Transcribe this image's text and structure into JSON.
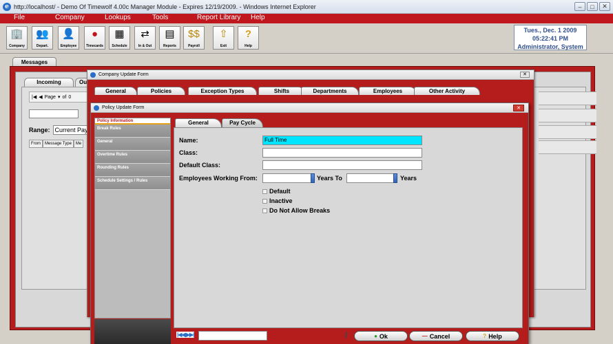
{
  "window": {
    "title": "http://localhost/ - Demo Of Timewolf 4.00c Manager Module - Expires 12/19/2009. - Windows Internet Explorer"
  },
  "menu": [
    "File",
    "Company",
    "Lookups",
    "Tools",
    "Report Library",
    "Help"
  ],
  "toolbar": [
    {
      "label": "Company",
      "icon": "company-icon"
    },
    {
      "label": "Depart.",
      "icon": "department-icon"
    },
    {
      "label": "Employee",
      "icon": "employee-icon"
    },
    {
      "label": "Timecards",
      "icon": "timecards-icon"
    },
    {
      "label": "Schedule",
      "icon": "schedule-icon"
    },
    {
      "label": "In & Out",
      "icon": "in-out-icon"
    },
    {
      "label": "Reports",
      "icon": "reports-icon"
    },
    {
      "label": "Payroll",
      "icon": "payroll-icon"
    },
    {
      "label": "Exit",
      "icon": "exit-icon"
    },
    {
      "label": "Help",
      "icon": "help-icon"
    }
  ],
  "status": {
    "date": "Tues., Dec. 1 2009",
    "time": "05:22:41 PM",
    "user": "Administrator, System"
  },
  "messages": {
    "tab": "Messages",
    "incoming_tab": "Incoming",
    "outgoing_tab": "Ou",
    "pager_label": "Page",
    "pager_of": "of",
    "pager_value": "0",
    "range_label": "Range:",
    "range_value": "Current Pay",
    "columns": [
      "From",
      "Message Type",
      "Me"
    ]
  },
  "company_form": {
    "title": "Company Update Form",
    "close": "✕",
    "tabs": [
      "General",
      "Policies",
      "Exception Types",
      "Shifts",
      "Departments",
      "Employees",
      "Other Activity"
    ],
    "active_tab": "Policies"
  },
  "policy_form": {
    "title": "Policy Update Form",
    "close": "✕",
    "sidebar": [
      "Policy Information",
      "Break Rules",
      "General",
      "Overtime Rules",
      "Rounding Rules",
      "Schedule Settings / Rules"
    ],
    "tabs": [
      "General",
      "Pay Cycle"
    ],
    "fields": {
      "name_label": "Name:",
      "name_value": "Full Time",
      "class_label": "Class:",
      "class_value": "",
      "default_class_label": "Default Class:",
      "default_class_value": "",
      "working_from_label": "Employees Working From:",
      "years_to_label": "Years To",
      "years_label": "Years"
    },
    "checkboxes": [
      "Default",
      "Inactive",
      "Do Not Allow Breaks"
    ],
    "footer": {
      "nav": "|◀◀ ▶▶|",
      "ok": "Ok",
      "cancel": "Cancel",
      "help": "Help"
    }
  }
}
